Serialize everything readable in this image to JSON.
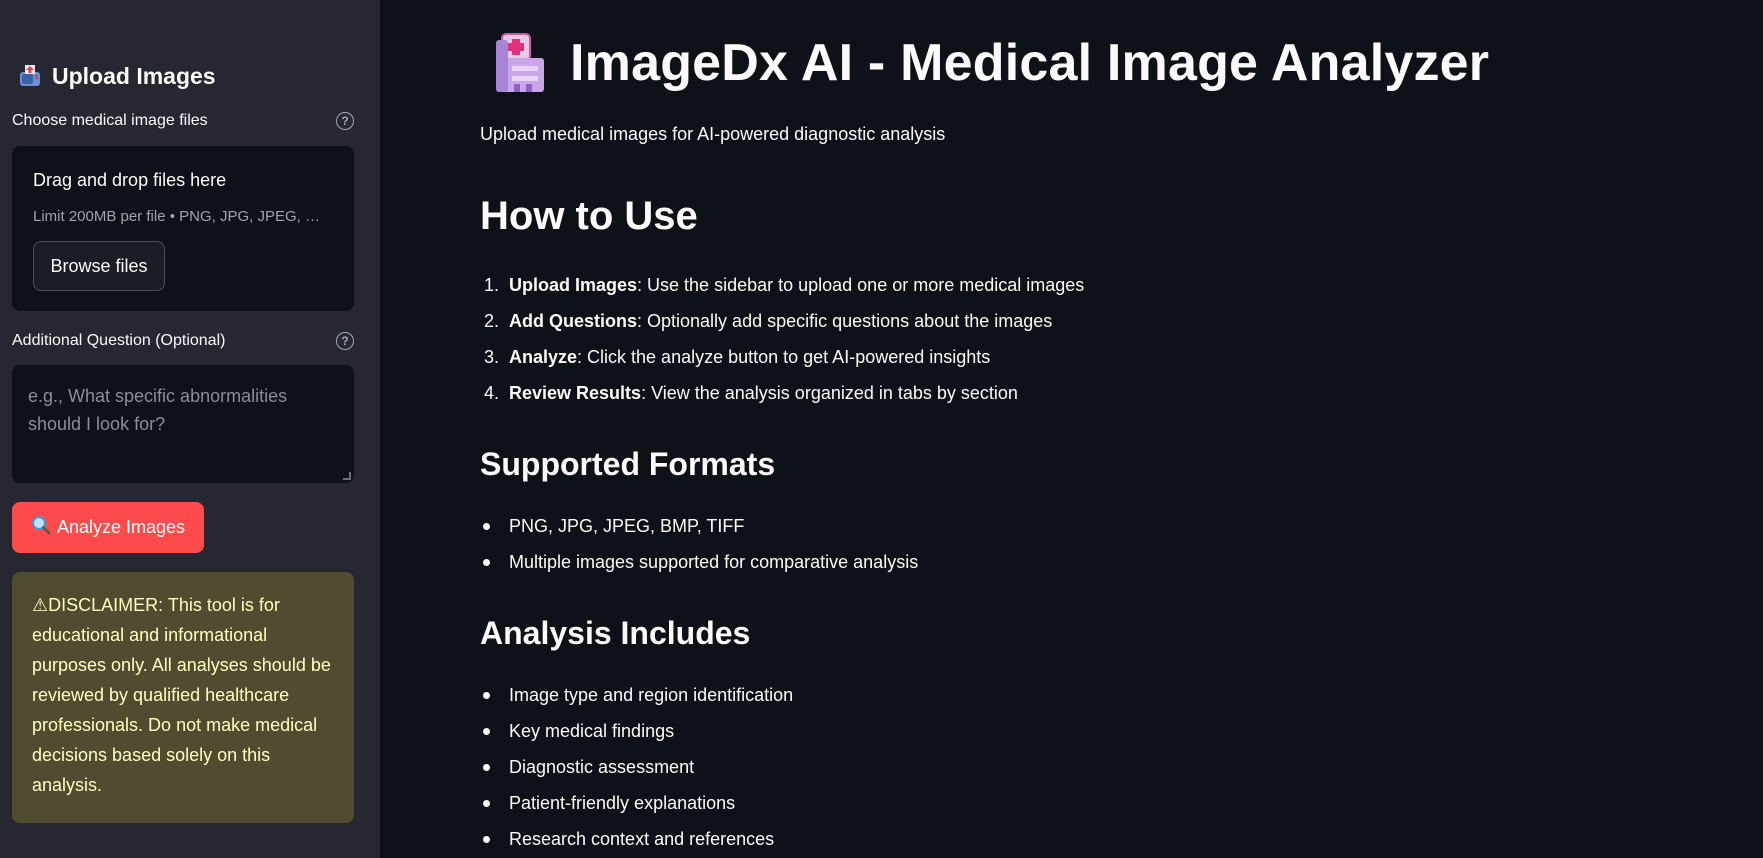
{
  "sidebar": {
    "header_title": "Upload Images",
    "uploader": {
      "label": "Choose medical image files",
      "drop_title": "Drag and drop files here",
      "drop_limit": "Limit 200MB per file • PNG, JPG, JPEG, …",
      "browse_label": "Browse files"
    },
    "question": {
      "label": "Additional Question (Optional)",
      "placeholder": "e.g., What specific abnormalities should I look for?"
    },
    "analyze_button": "Analyze Images",
    "disclaimer": "⚠DISCLAIMER: This tool is for educational and informational purposes only. All analyses should be reviewed by qualified healthcare professionals. Do not make medical decisions based solely on this analysis."
  },
  "main": {
    "title": "ImageDx AI - Medical Image Analyzer",
    "subtitle": "Upload medical images for AI-powered diagnostic analysis",
    "how_to_use": {
      "heading": "How to Use",
      "steps": [
        {
          "num": "1.",
          "bold": "Upload Images",
          "text": ": Use the sidebar to upload one or more medical images"
        },
        {
          "num": "2.",
          "bold": "Add Questions",
          "text": ": Optionally add specific questions about the images"
        },
        {
          "num": "3.",
          "bold": "Analyze",
          "text": ": Click the analyze button to get AI-powered insights"
        },
        {
          "num": "4.",
          "bold": "Review Results",
          "text": ": View the analysis organized in tabs by section"
        }
      ]
    },
    "supported_formats": {
      "heading": "Supported Formats",
      "items": [
        "PNG, JPG, JPEG, BMP, TIFF",
        "Multiple images supported for comparative analysis"
      ]
    },
    "analysis_includes": {
      "heading": "Analysis Includes",
      "items": [
        "Image type and region identification",
        "Key medical findings",
        "Diagnostic assessment",
        "Patient-friendly explanations",
        "Research context and references"
      ]
    }
  },
  "colors": {
    "sidebar_bg": "#262730",
    "main_bg": "#0e1117",
    "primary_button": "#ff4b4b",
    "disclaimer_bg": "#4f4c2f",
    "disclaimer_text": "#ffffc2"
  },
  "icons": {
    "sidebar_header": "mailbox-upload-icon",
    "title": "hospital-icon",
    "analyze": "magnifying-glass-icon",
    "help": "help-circle-icon"
  }
}
